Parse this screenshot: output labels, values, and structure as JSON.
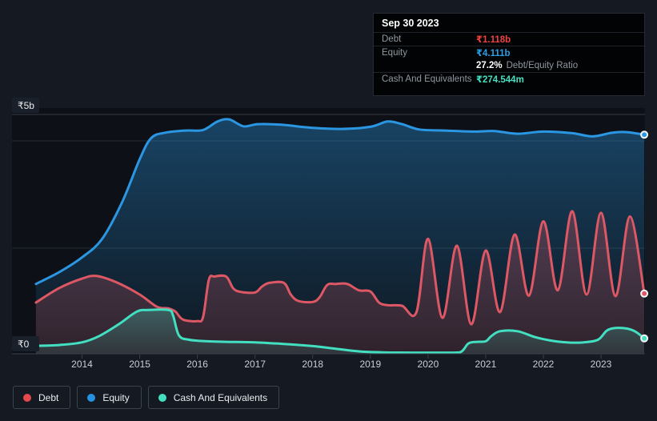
{
  "tooltip": {
    "title": "Sep 30 2023",
    "debt_label": "Debt",
    "debt_value": "₹1.118b",
    "equity_label": "Equity",
    "equity_value": "₹4.111b",
    "ratio_value": "27.2%",
    "ratio_caption": "Debt/Equity Ratio",
    "cash_label": "Cash And Equivalents",
    "cash_value": "₹274.544m"
  },
  "legend": {
    "items": [
      {
        "label": "Debt",
        "color": "#e5484d"
      },
      {
        "label": "Equity",
        "color": "#2593e2"
      },
      {
        "label": "Cash And Equivalents",
        "color": "#42dfc1"
      }
    ]
  },
  "colors": {
    "background": "#151a22",
    "plot_background": "#0d1117",
    "gridline": "#242b36",
    "gridline_top": "#323946",
    "axis_line": "#3a414d",
    "axis_label": "#e9ebee",
    "year_label": "#c9ced6"
  },
  "chart_data": {
    "type": "area",
    "x_ticks": [
      2014,
      2015,
      2016,
      2017,
      2018,
      2019,
      2020,
      2021,
      2022,
      2023
    ],
    "y_ticks": [
      {
        "label": "₹5b",
        "value": 5
      },
      {
        "label": "₹0",
        "value": 0
      }
    ],
    "y_unit": "INR billions",
    "xlim": [
      2013.2,
      2023.77
    ],
    "ylim": [
      0,
      5
    ],
    "grid": "horizontal",
    "legend_position": "bottom-left",
    "series": [
      {
        "name": "Equity",
        "color": "#2b96e2",
        "end_value": "₹4.111b",
        "points": [
          [
            2013.2,
            1.3
          ],
          [
            2013.6,
            1.52
          ],
          [
            2014.0,
            1.8
          ],
          [
            2014.35,
            2.15
          ],
          [
            2014.7,
            2.85
          ],
          [
            2015.0,
            3.65
          ],
          [
            2015.2,
            4.05
          ],
          [
            2015.45,
            4.15
          ],
          [
            2015.8,
            4.19
          ],
          [
            2016.1,
            4.2
          ],
          [
            2016.35,
            4.36
          ],
          [
            2016.55,
            4.4
          ],
          [
            2016.8,
            4.27
          ],
          [
            2017.05,
            4.31
          ],
          [
            2017.45,
            4.3
          ],
          [
            2018.0,
            4.24
          ],
          [
            2018.5,
            4.22
          ],
          [
            2019.0,
            4.26
          ],
          [
            2019.3,
            4.36
          ],
          [
            2019.55,
            4.31
          ],
          [
            2019.85,
            4.21
          ],
          [
            2020.3,
            4.19
          ],
          [
            2020.8,
            4.17
          ],
          [
            2021.15,
            4.18
          ],
          [
            2021.55,
            4.13
          ],
          [
            2022.0,
            4.17
          ],
          [
            2022.5,
            4.14
          ],
          [
            2022.85,
            4.08
          ],
          [
            2023.2,
            4.15
          ],
          [
            2023.45,
            4.16
          ],
          [
            2023.75,
            4.111
          ]
        ]
      },
      {
        "name": "Debt",
        "color": "#dd5864",
        "end_value": "₹1.118b",
        "points": [
          [
            2013.2,
            0.95
          ],
          [
            2013.6,
            1.22
          ],
          [
            2014.0,
            1.4
          ],
          [
            2014.25,
            1.45
          ],
          [
            2014.6,
            1.33
          ],
          [
            2015.0,
            1.1
          ],
          [
            2015.3,
            0.87
          ],
          [
            2015.5,
            0.84
          ],
          [
            2015.62,
            0.78
          ],
          [
            2015.75,
            0.63
          ],
          [
            2016.0,
            0.6
          ],
          [
            2016.1,
            0.68
          ],
          [
            2016.2,
            1.38
          ],
          [
            2016.3,
            1.44
          ],
          [
            2016.5,
            1.44
          ],
          [
            2016.62,
            1.22
          ],
          [
            2016.75,
            1.15
          ],
          [
            2017.0,
            1.14
          ],
          [
            2017.12,
            1.25
          ],
          [
            2017.25,
            1.32
          ],
          [
            2017.5,
            1.32
          ],
          [
            2017.62,
            1.1
          ],
          [
            2017.75,
            0.98
          ],
          [
            2018.0,
            0.96
          ],
          [
            2018.12,
            1.05
          ],
          [
            2018.25,
            1.28
          ],
          [
            2018.4,
            1.3
          ],
          [
            2018.6,
            1.3
          ],
          [
            2018.8,
            1.18
          ],
          [
            2019.0,
            1.16
          ],
          [
            2019.15,
            0.95
          ],
          [
            2019.3,
            0.9
          ],
          [
            2019.55,
            0.89
          ],
          [
            2019.8,
            0.77
          ],
          [
            2020.0,
            2.15
          ],
          [
            2020.25,
            0.66
          ],
          [
            2020.5,
            2.02
          ],
          [
            2020.75,
            0.54
          ],
          [
            2021.0,
            1.93
          ],
          [
            2021.25,
            0.77
          ],
          [
            2021.5,
            2.23
          ],
          [
            2021.75,
            1.08
          ],
          [
            2022.0,
            2.48
          ],
          [
            2022.25,
            1.18
          ],
          [
            2022.5,
            2.67
          ],
          [
            2022.75,
            1.1
          ],
          [
            2023.0,
            2.64
          ],
          [
            2023.25,
            1.07
          ],
          [
            2023.5,
            2.57
          ],
          [
            2023.75,
            1.118
          ]
        ]
      },
      {
        "name": "Cash And Equivalents",
        "color": "#42dfc1",
        "end_value": "₹274.544m",
        "points": [
          [
            2013.2,
            0.135
          ],
          [
            2013.6,
            0.15
          ],
          [
            2014.0,
            0.2
          ],
          [
            2014.3,
            0.32
          ],
          [
            2014.65,
            0.55
          ],
          [
            2014.95,
            0.78
          ],
          [
            2015.15,
            0.81
          ],
          [
            2015.5,
            0.81
          ],
          [
            2015.58,
            0.7
          ],
          [
            2015.68,
            0.33
          ],
          [
            2015.85,
            0.25
          ],
          [
            2016.1,
            0.225
          ],
          [
            2016.5,
            0.21
          ],
          [
            2017.0,
            0.2
          ],
          [
            2017.5,
            0.17
          ],
          [
            2018.0,
            0.13
          ],
          [
            2018.4,
            0.08
          ],
          [
            2018.8,
            0.03
          ],
          [
            2019.2,
            0.012
          ],
          [
            2019.7,
            0.006
          ],
          [
            2020.2,
            0.006
          ],
          [
            2020.55,
            0.01
          ],
          [
            2020.7,
            0.18
          ],
          [
            2020.85,
            0.21
          ],
          [
            2021.0,
            0.22
          ],
          [
            2021.1,
            0.32
          ],
          [
            2021.25,
            0.41
          ],
          [
            2021.55,
            0.41
          ],
          [
            2021.85,
            0.3
          ],
          [
            2022.1,
            0.24
          ],
          [
            2022.4,
            0.2
          ],
          [
            2022.7,
            0.2
          ],
          [
            2022.95,
            0.25
          ],
          [
            2023.1,
            0.42
          ],
          [
            2023.25,
            0.47
          ],
          [
            2023.45,
            0.46
          ],
          [
            2023.6,
            0.4
          ],
          [
            2023.75,
            0.2745
          ]
        ]
      }
    ]
  }
}
